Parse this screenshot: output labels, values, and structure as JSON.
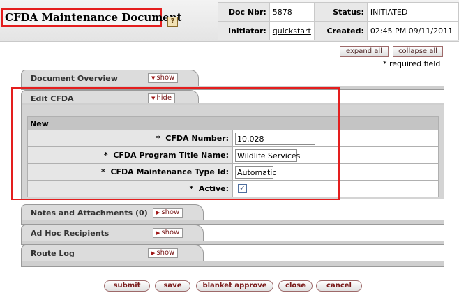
{
  "header": {
    "title": "CFDA Maintenance Document",
    "help_icon": "?",
    "doc_nbr_label": "Doc Nbr:",
    "doc_nbr": "5878",
    "status_label": "Status:",
    "status": "INITIATED",
    "initiator_label": "Initiator:",
    "initiator": "quickstart",
    "created_label": "Created:",
    "created": "02:45 PM 09/11/2011"
  },
  "global": {
    "expand_all": "expand all",
    "collapse_all": "collapse all",
    "required_note": "* required field"
  },
  "tabs": {
    "document_overview": {
      "label": "Document Overview",
      "toggle": "show"
    },
    "edit_cfda": {
      "label": "Edit CFDA",
      "toggle": "hide"
    },
    "notes": {
      "label": "Notes and Attachments (0)",
      "toggle": "show"
    },
    "adhoc": {
      "label": "Ad Hoc Recipients",
      "toggle": "show"
    },
    "route_log": {
      "label": "Route Log",
      "toggle": "show"
    }
  },
  "form": {
    "section": "New",
    "required_marker": "*",
    "fields": {
      "number": {
        "label": "CFDA Number:",
        "value": "10.028"
      },
      "title": {
        "label": "CFDA Program Title Name:",
        "value": "Wildlife Services"
      },
      "type": {
        "label": "CFDA Maintenance Type Id:",
        "value": "Automatic"
      },
      "active": {
        "label": "Active:",
        "checked": true,
        "mark": "✓"
      }
    }
  },
  "actions": {
    "submit": "submit",
    "save": "save",
    "blanket_approve": "blanket approve",
    "close": "close",
    "cancel": "cancel"
  },
  "colors": {
    "highlight": "#e41e1e",
    "tab_bg": "#dcdcdc",
    "button_text": "#7a1a1a"
  }
}
